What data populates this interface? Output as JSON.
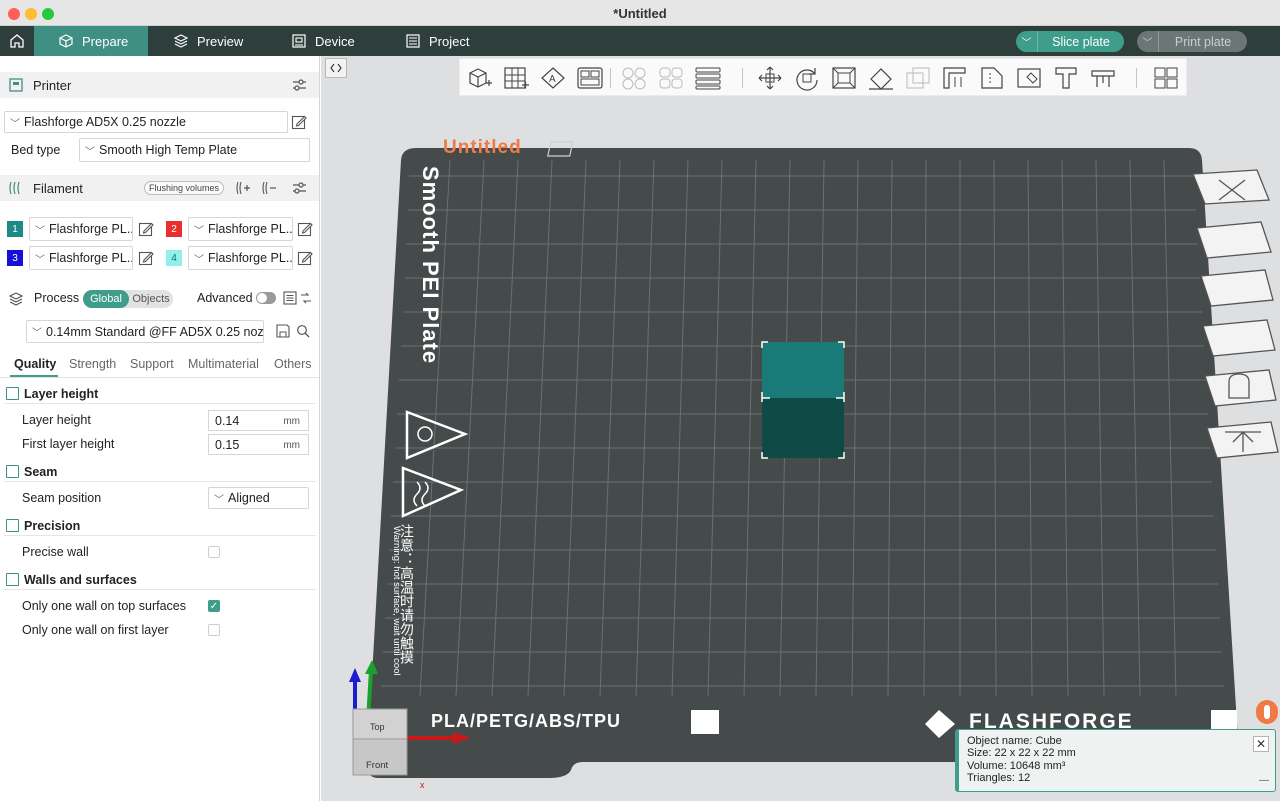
{
  "window": {
    "title": "*Untitled"
  },
  "tabs": [
    {
      "label": "Prepare",
      "active": true
    },
    {
      "label": "Preview",
      "active": false
    },
    {
      "label": "Device",
      "active": false
    },
    {
      "label": "Project",
      "active": false
    }
  ],
  "actions": {
    "slice": "Slice plate",
    "print": "Print plate"
  },
  "printer": {
    "section_title": "Printer",
    "name": "Flashforge AD5X 0.25 nozzle",
    "bed_type_label": "Bed type",
    "bed_type": "Smooth High Temp Plate"
  },
  "filament": {
    "section_title": "Filament",
    "flushing_label": "Flushing volumes",
    "slots": [
      {
        "num": "1",
        "color": "#1c8a86",
        "name": "Flashforge PL..."
      },
      {
        "num": "2",
        "color": "#e8312c",
        "name": "Flashforge PL..."
      },
      {
        "num": "3",
        "color": "#1410d8",
        "name": "Flashforge PL..."
      },
      {
        "num": "4",
        "color": "#8ef1ee",
        "name": "Flashforge PL..."
      }
    ]
  },
  "process": {
    "section_title": "Process",
    "global_label": "Global",
    "objects_label": "Objects",
    "advanced_label": "Advanced",
    "advanced_on": false,
    "preset": "0.14mm Standard @FF AD5X 0.25 nozz...",
    "tabs": [
      "Quality",
      "Strength",
      "Support",
      "Multimaterial",
      "Others"
    ],
    "active_tab": "Quality"
  },
  "quality": {
    "layer_height_group": "Layer height",
    "layer_height_label": "Layer height",
    "layer_height_value": "0.14",
    "first_layer_height_label": "First layer height",
    "first_layer_height_value": "0.15",
    "unit": "mm",
    "seam_group": "Seam",
    "seam_position_label": "Seam position",
    "seam_position_value": "Aligned",
    "precision_group": "Precision",
    "precise_wall_label": "Precise wall",
    "precise_wall_checked": false,
    "walls_group": "Walls and surfaces",
    "top_one_wall_label": "Only one wall on top surfaces",
    "top_one_wall_checked": true,
    "first_layer_one_wall_label": "Only one wall on first layer",
    "first_layer_one_wall_checked": false
  },
  "plate": {
    "name": "Untitled",
    "bed_label": "Smooth PEI Plate",
    "materials": "PLA/PETG/ABS/TPU",
    "brand": "FLASHFORGE",
    "warning_cn": "注意：高温时请勿触摸",
    "warning_en": "Warning: hot surface, wait until cool"
  },
  "view_cube": {
    "top": "Top",
    "front": "Front",
    "axis_x": "x"
  },
  "object_info": {
    "name_line": "Object name: Cube",
    "size_line": "Size: 22 x 22 x 22 mm",
    "volume_line": "Volume: 10648 mm³",
    "triangles_line": "Triangles: 12"
  },
  "colors": {
    "accent": "#3f9d8b",
    "tabbar": "#2d3e3b",
    "bed": "#454a4a",
    "cube_top": "#1a7a77",
    "cube_front": "#0f4a47",
    "plate_name": "#f07a45"
  }
}
